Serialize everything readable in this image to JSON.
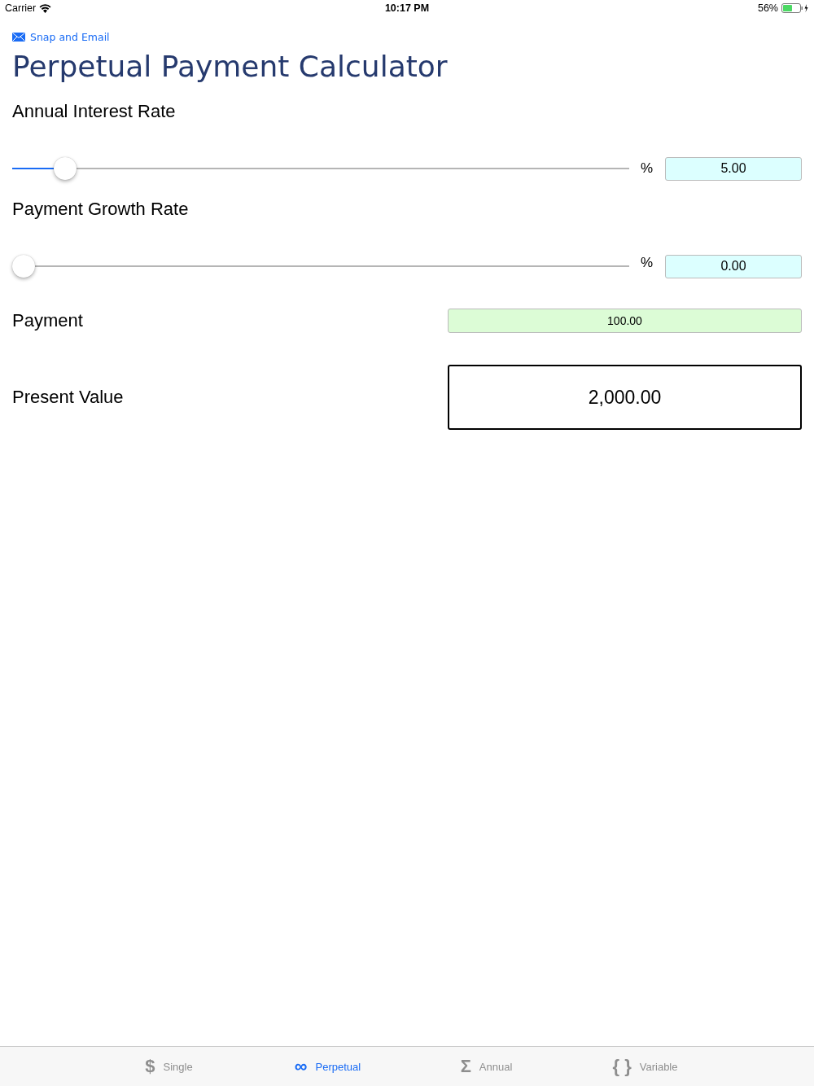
{
  "status_bar": {
    "carrier": "Carrier",
    "time": "10:17 PM",
    "battery": "56%"
  },
  "share_link": "Snap and Email",
  "title": "Perpetual Payment Calculator",
  "sliders": [
    {
      "label": "Annual Interest Rate",
      "level": 0.07,
      "unit": "%",
      "value": "5.00"
    },
    {
      "label": "Payment Growth Rate",
      "level": 0,
      "unit": "%",
      "value": "0.00"
    }
  ],
  "payment": {
    "label": "Payment",
    "value": "100.00"
  },
  "present_value": {
    "label": "Present Value",
    "value": "2,000.00"
  },
  "tabs": [
    {
      "icon": "$",
      "label": "Single",
      "selected": false
    },
    {
      "icon": "∞",
      "label": "Perpetual",
      "selected": true
    },
    {
      "icon": "Σ",
      "label": "Annual",
      "selected": false
    },
    {
      "icon": "{ }",
      "label": "Variable",
      "selected": false
    }
  ]
}
